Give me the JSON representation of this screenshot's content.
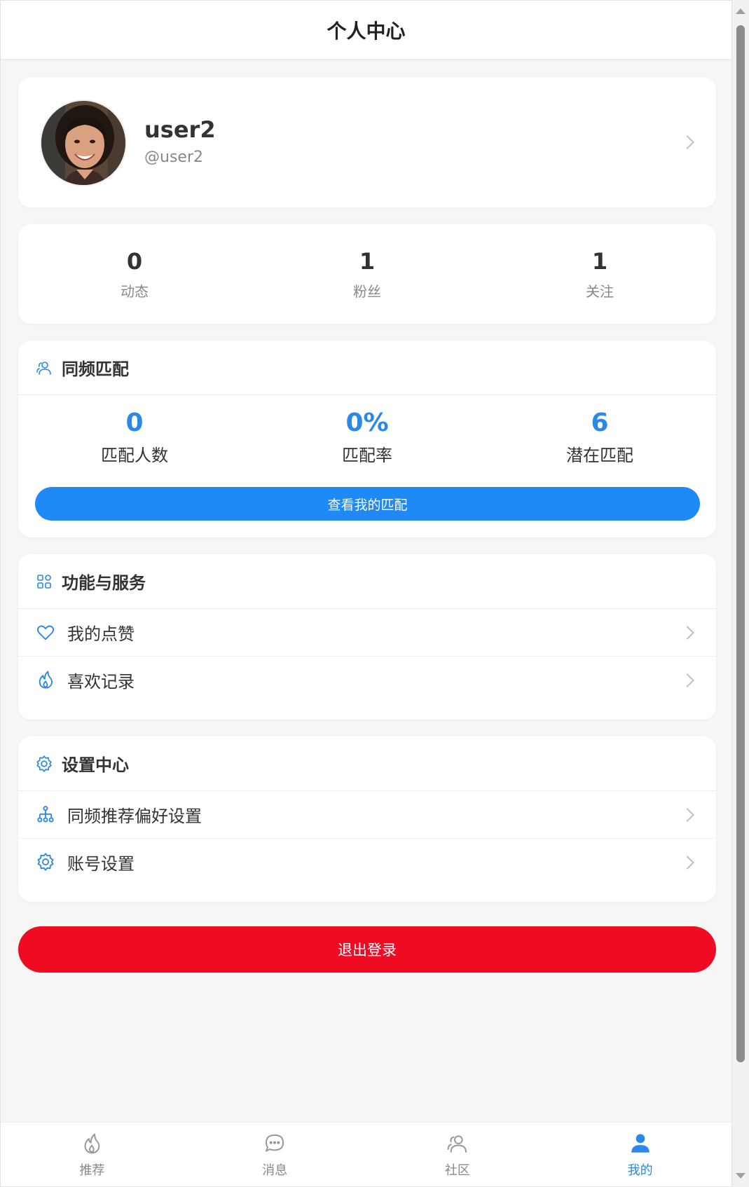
{
  "header": {
    "title": "个人中心"
  },
  "profile": {
    "name": "user2",
    "handle": "@user2"
  },
  "stats": [
    {
      "value": "0",
      "label": "动态"
    },
    {
      "value": "1",
      "label": "粉丝"
    },
    {
      "value": "1",
      "label": "关注"
    }
  ],
  "match": {
    "title": "同频匹配",
    "stats": [
      {
        "value": "0",
        "label": "匹配人数"
      },
      {
        "value": "0%",
        "label": "匹配率"
      },
      {
        "value": "6",
        "label": "潜在匹配"
      }
    ],
    "button_label": "查看我的匹配"
  },
  "services": {
    "title": "功能与服务",
    "items": [
      {
        "label": "我的点赞",
        "icon": "heart-icon"
      },
      {
        "label": "喜欢记录",
        "icon": "fire-icon"
      }
    ]
  },
  "settings": {
    "title": "设置中心",
    "items": [
      {
        "label": "同频推荐偏好设置",
        "icon": "hierarchy-icon"
      },
      {
        "label": "账号设置",
        "icon": "gear-icon"
      }
    ]
  },
  "logout_label": "退出登录",
  "tabs": [
    {
      "label": "推荐",
      "icon": "fire-icon",
      "active": false
    },
    {
      "label": "消息",
      "icon": "chat-icon",
      "active": false
    },
    {
      "label": "社区",
      "icon": "people-icon",
      "active": false
    },
    {
      "label": "我的",
      "icon": "person-icon",
      "active": true
    }
  ],
  "colors": {
    "accent": "#2b88e6",
    "button_blue": "#1f89f5",
    "logout_red": "#ef0c22",
    "background": "#f6f6f7"
  }
}
